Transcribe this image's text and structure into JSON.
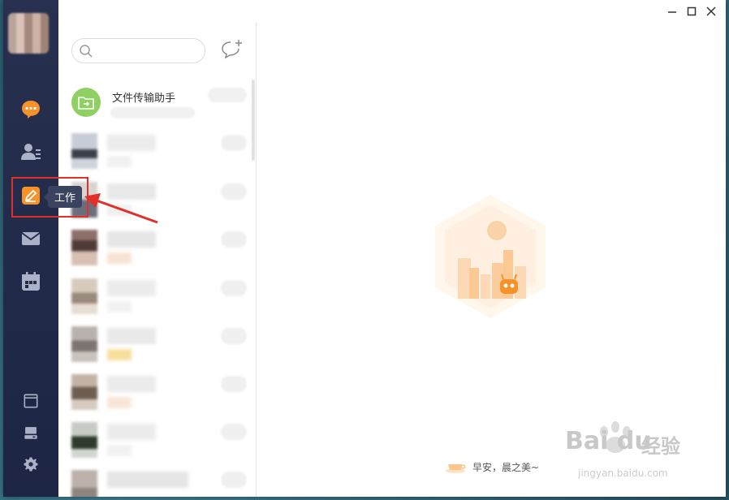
{
  "titlebar": {
    "buttons": [
      "minimize-icon",
      "maximize-icon",
      "close-icon"
    ]
  },
  "nav": {
    "items": [
      {
        "name": "chat",
        "icon": "chat-bubble-icon",
        "color": "#f5922a"
      },
      {
        "name": "contacts",
        "icon": "contacts-icon",
        "color": "#aab2c8"
      },
      {
        "name": "work",
        "icon": "edit-icon",
        "color": "#f5922a",
        "selected": true
      },
      {
        "name": "mail",
        "icon": "mail-icon",
        "color": "#aab2c8"
      },
      {
        "name": "calendar",
        "icon": "calendar-icon",
        "color": "#aab2c8"
      }
    ],
    "bottom": [
      "window-icon",
      "device-icon",
      "gear-icon"
    ],
    "tooltip": "工作"
  },
  "search": {
    "placeholder": ""
  },
  "list": {
    "helper": {
      "name": "文件传输助手",
      "icon": "folder-transfer-icon",
      "color": "#8fcf63"
    }
  },
  "main": {
    "greeting": "早安，晨之美~",
    "illustration": "city-robot-illustration"
  },
  "watermark": {
    "brand": "Bai du",
    "brand_cn": "经验",
    "url": "jingyan.baidu.com"
  },
  "colors": {
    "accent": "#f5922a",
    "nav_bg": "#222b4a",
    "highlight_border": "#e0302a"
  }
}
